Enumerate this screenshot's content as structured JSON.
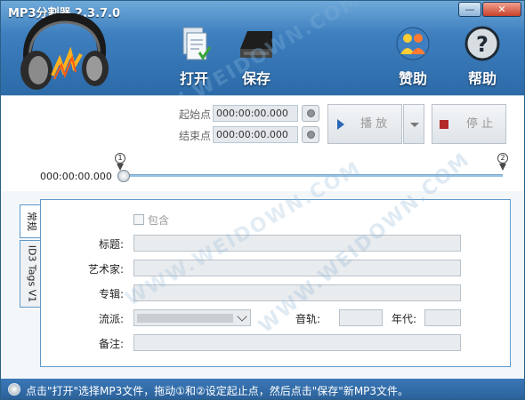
{
  "window": {
    "title": "MP3分割器 2.3.7.0",
    "minimize_glyph": "—",
    "close_glyph": "✕"
  },
  "toolbar": {
    "open_label": "打开",
    "save_label": "保存",
    "donate_label": "赞助",
    "help_label": "帮助"
  },
  "range": {
    "start_label": "起始点",
    "start_value": "000:00:00.000",
    "end_label": "结束点",
    "end_value": "000:00:00.000"
  },
  "playback": {
    "play_label": "播 放",
    "stop_label": "停 止",
    "position_time": "000:00:00.000",
    "start_marker": "1",
    "end_marker": "2",
    "progress": 0
  },
  "tabs": {
    "general": "常规",
    "id3": "ID3 Tags V1"
  },
  "tags": {
    "include_label": "包含",
    "title_label": "标题:",
    "artist_label": "艺术家:",
    "album_label": "专辑:",
    "genre_label": "流派:",
    "track_label": "音轨:",
    "year_label": "年代:",
    "comment_label": "备注:",
    "title_value": "",
    "artist_value": "",
    "album_value": "",
    "genre_value": "",
    "track_value": "",
    "year_value": "",
    "comment_value": ""
  },
  "status": {
    "text": "点击\"打开\"选择MP3文件，拖动①和②设定起止点，然后点击\"保存\"新MP3文件。"
  },
  "watermark": "WWW.WEIDOWN.COM",
  "colors": {
    "header": "#3e7fbf",
    "statusbar": "#2a5f97",
    "accent_blue": "#2a66b8",
    "stop_red": "#b22a2a",
    "panel_border": "#5f9acb"
  },
  "icons": {
    "logo": "headphones-icon",
    "open": "document-icon",
    "save": "disk-icon",
    "donate": "people-icon",
    "help": "question-icon",
    "play": "play-icon",
    "stop": "stop-icon"
  }
}
